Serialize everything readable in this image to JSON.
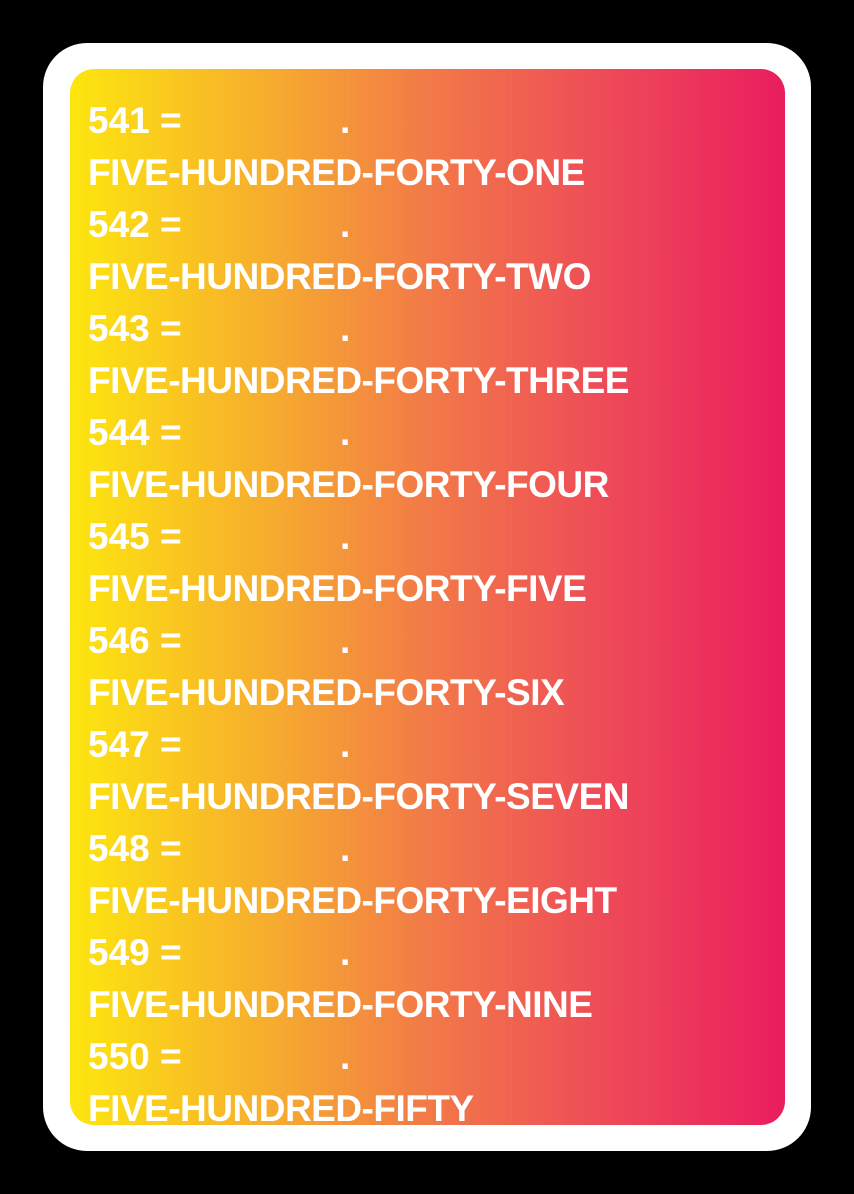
{
  "entries": [
    {
      "equation": "541 =",
      "dot": ".",
      "words": "FIVE-HUNDRED-FORTY-ONE"
    },
    {
      "equation": "542 =",
      "dot": ".",
      "words": "FIVE-HUNDRED-FORTY-TWO"
    },
    {
      "equation": "543 =",
      "dot": ".",
      "words": "FIVE-HUNDRED-FORTY-THREE"
    },
    {
      "equation": "544 =",
      "dot": ".",
      "words": "FIVE-HUNDRED-FORTY-FOUR"
    },
    {
      "equation": "545 =",
      "dot": ".",
      "words": "FIVE-HUNDRED-FORTY-FIVE"
    },
    {
      "equation": "546 =",
      "dot": ".",
      "words": "FIVE-HUNDRED-FORTY-SIX"
    },
    {
      "equation": "547 =",
      "dot": ".",
      "words": "FIVE-HUNDRED-FORTY-SEVEN"
    },
    {
      "equation": "548 =",
      "dot": ".",
      "words": "FIVE-HUNDRED-FORTY-EIGHT"
    },
    {
      "equation": "549 =",
      "dot": ".",
      "words": "FIVE-HUNDRED-FORTY-NINE"
    },
    {
      "equation": "550 =",
      "dot": ".",
      "words": "FIVE-HUNDRED-FIFTY"
    }
  ],
  "colors": {
    "background": "#000000",
    "card": "#ffffff",
    "gradient_start": "#fde60f",
    "gradient_end": "#ea1d5f",
    "text": "#ffffff"
  }
}
